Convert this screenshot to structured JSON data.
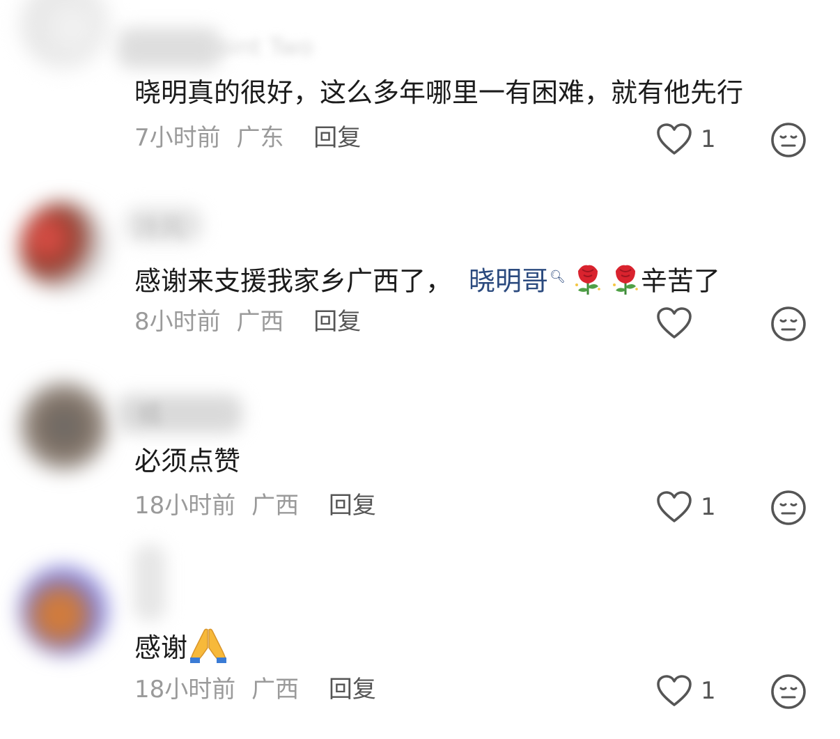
{
  "comments": [
    {
      "username": "oint Two",
      "text": "晓明真的很好，这么多年哪里一有困难，就有他先行",
      "time": "7小时前",
      "location": "广东",
      "reply_label": "回复",
      "like_count": "1"
    },
    {
      "username": "冷风",
      "text_before": "感谢来支援我家乡广西了，",
      "mention": "晓明哥",
      "text_after": "辛苦了",
      "emojis": [
        "rose-emoji",
        "rose-emoji"
      ],
      "time": "8小时前",
      "location": "广西",
      "reply_label": "回复",
      "like_count": ""
    },
    {
      "username": "橘",
      "text": "必须点赞",
      "time": "18小时前",
      "location": "广西",
      "reply_label": "回复",
      "like_count": "1"
    },
    {
      "username": "",
      "text": "感谢",
      "emojis": [
        "folded-hands-emoji"
      ],
      "time": "18小时前",
      "location": "广西",
      "reply_label": "回复",
      "like_count": "1"
    }
  ],
  "icons": {
    "like": "heart-outline-icon",
    "dislike": "neutral-face-icon"
  },
  "colors": {
    "text": "#1b1b1b",
    "meta": "#9a9a9a",
    "mention": "#2b4a7e",
    "icon": "#555555"
  }
}
